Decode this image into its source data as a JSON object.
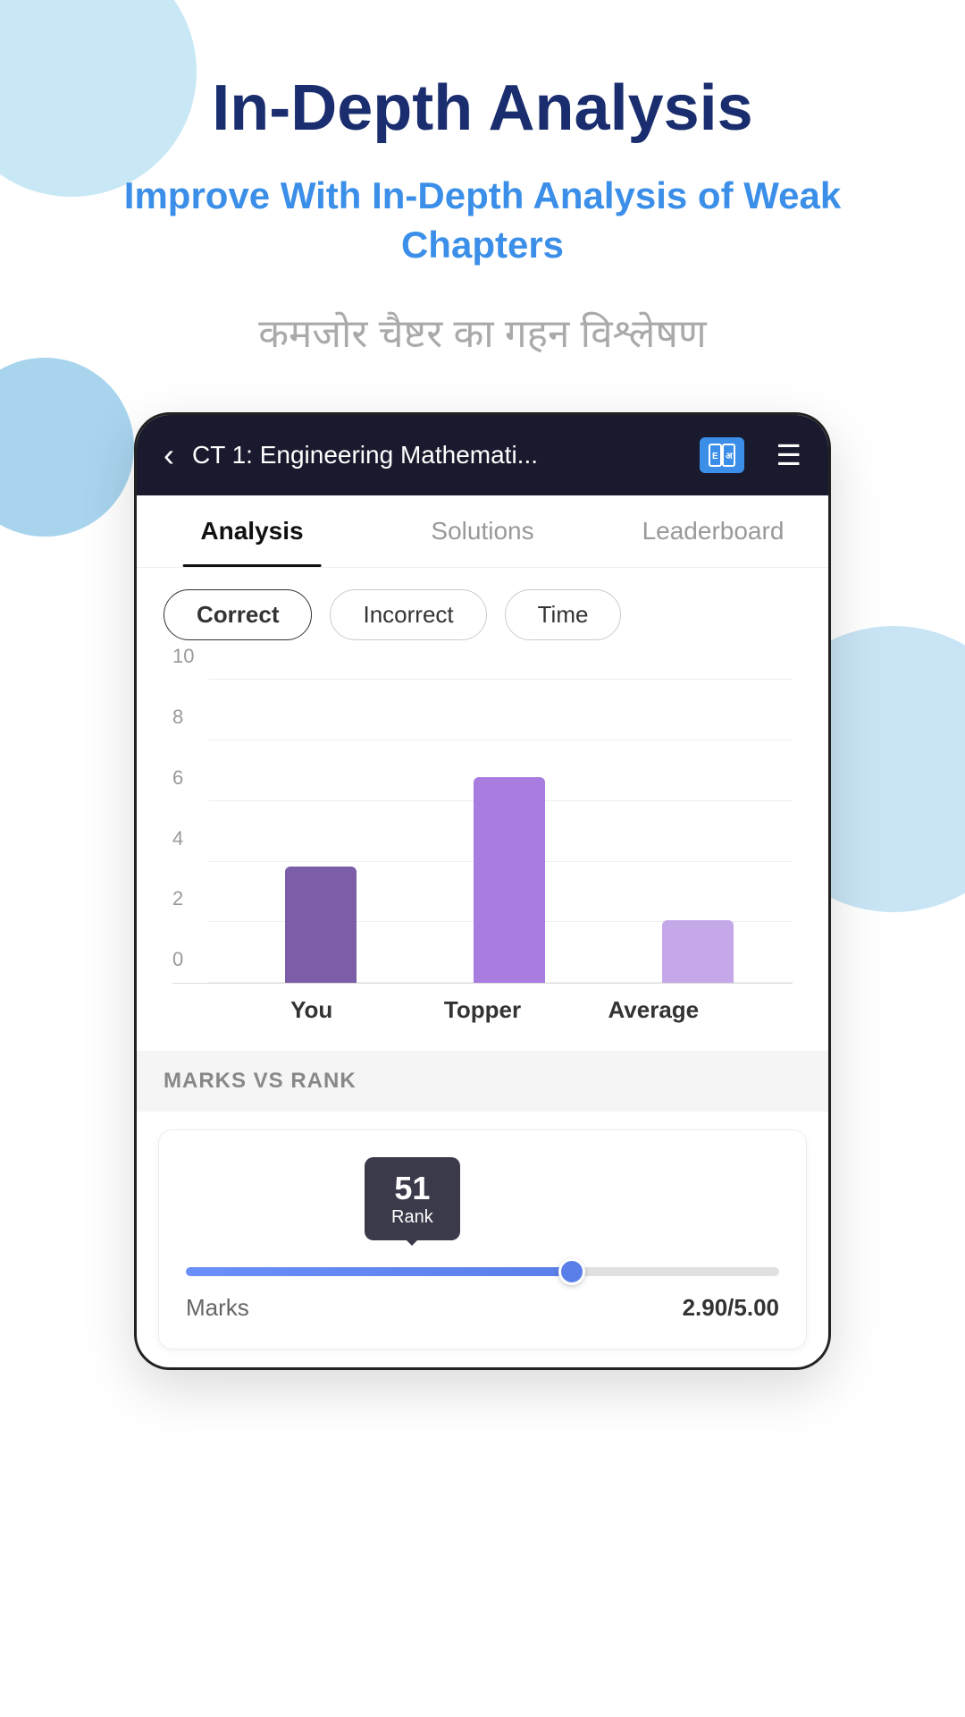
{
  "page": {
    "main_title": "In-Depth Analysis",
    "subtitle": "Improve With In-Depth Analysis of Weak Chapters",
    "hindi_text": "कमजोर चैष्टर का गहन विश्लेषण"
  },
  "header": {
    "title": "CT 1: Engineering Mathemati...",
    "back_label": "‹",
    "hamburger_label": "☰"
  },
  "tabs": [
    {
      "label": "Analysis",
      "active": true
    },
    {
      "label": "Solutions",
      "active": false
    },
    {
      "label": "Leaderboard",
      "active": false
    }
  ],
  "filters": [
    {
      "label": "Correct",
      "active": true
    },
    {
      "label": "Incorrect",
      "active": false
    },
    {
      "label": "Time",
      "active": false
    }
  ],
  "chart": {
    "y_labels": [
      "10",
      "8",
      "6",
      "4",
      "2",
      "0"
    ],
    "bars": [
      {
        "label": "You",
        "type": "you"
      },
      {
        "label": "Topper",
        "type": "topper"
      },
      {
        "label": "Average",
        "type": "average"
      }
    ]
  },
  "marks_vs_rank": {
    "section_title": "MARKS VS RANK",
    "rank_value": "51",
    "rank_sublabel": "Rank",
    "marks_label": "Marks",
    "marks_value": "2.90/5.00"
  }
}
